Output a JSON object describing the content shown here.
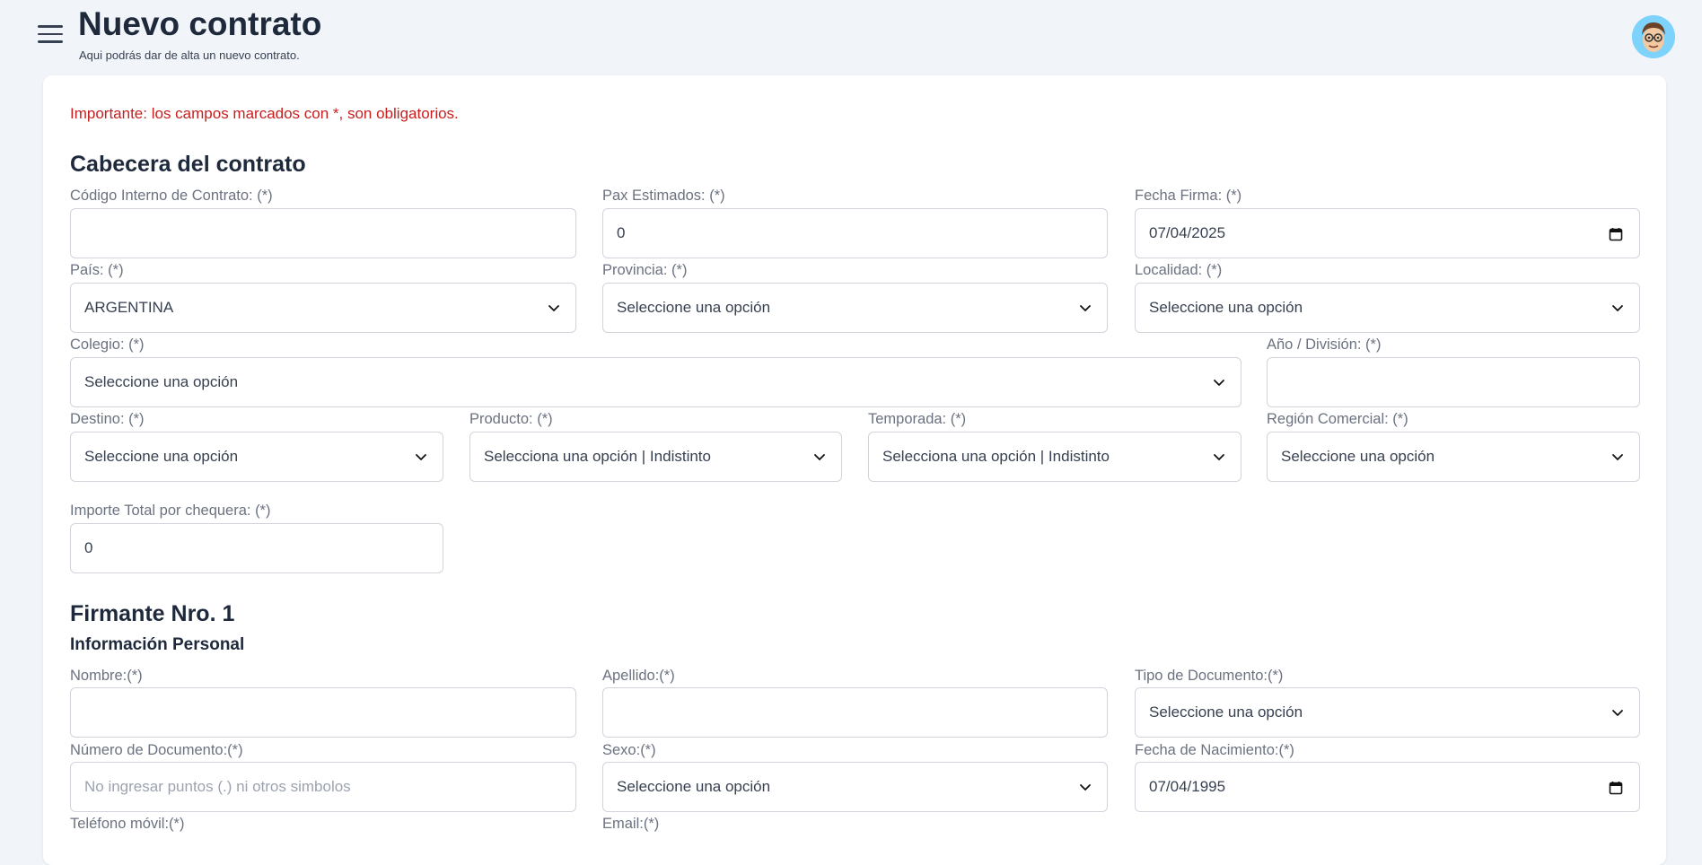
{
  "header": {
    "title": "Nuevo contrato",
    "subtitle": "Aqui podrás dar de alta un nuevo contrato."
  },
  "notice": "Importante: los campos marcados con *, son obligatorios.",
  "contract_header": {
    "title": "Cabecera del contrato",
    "codigo": {
      "label": "Código Interno de Contrato: (*)",
      "value": ""
    },
    "pax": {
      "label": "Pax Estimados: (*)",
      "value": "0"
    },
    "fecha_firma": {
      "label": "Fecha Firma: (*)",
      "value": "07/04/2025"
    },
    "pais": {
      "label": "País: (*)",
      "value": "ARGENTINA"
    },
    "provincia": {
      "label": "Provincia: (*)",
      "value": "Seleccione una opción"
    },
    "localidad": {
      "label": "Localidad: (*)",
      "value": "Seleccione una opción"
    },
    "colegio": {
      "label": "Colegio: (*)",
      "value": "Seleccione una opción"
    },
    "anio_division": {
      "label": "Año / División: (*)",
      "value": ""
    },
    "destino": {
      "label": "Destino: (*)",
      "value": "Seleccione una opción"
    },
    "producto": {
      "label": "Producto: (*)",
      "value": "Selecciona una opción | Indistinto"
    },
    "temporada": {
      "label": "Temporada: (*)",
      "value": "Selecciona una opción | Indistinto"
    },
    "region": {
      "label": "Región Comercial: (*)",
      "value": "Seleccione una opción"
    },
    "importe": {
      "label": "Importe Total por chequera: (*)",
      "value": "0"
    }
  },
  "signer": {
    "title": "Firmante Nro. 1",
    "personal_title": "Información Personal",
    "nombre": {
      "label": "Nombre:(*)",
      "value": ""
    },
    "apellido": {
      "label": "Apellido:(*)",
      "value": ""
    },
    "tipo_doc": {
      "label": "Tipo de Documento:(*)",
      "value": "Seleccione una opción"
    },
    "num_doc": {
      "label": "Número de Documento:(*)",
      "placeholder": "No ingresar puntos (.) ni otros simbolos"
    },
    "sexo": {
      "label": "Sexo:(*)",
      "value": "Seleccione una opción"
    },
    "fecha_nac": {
      "label": "Fecha de Nacimiento:(*)",
      "value": "07/04/1995"
    },
    "telefono": {
      "label": "Teléfono móvil:(*)"
    },
    "email": {
      "label": "Email:(*)"
    }
  },
  "icons": [
    "menu-icon",
    "avatar-icon",
    "chevron-down-icon",
    "calendar-icon"
  ],
  "colors": {
    "accent_notice": "#c81e1e",
    "background": "#f1f5f9",
    "card": "#ffffff"
  }
}
